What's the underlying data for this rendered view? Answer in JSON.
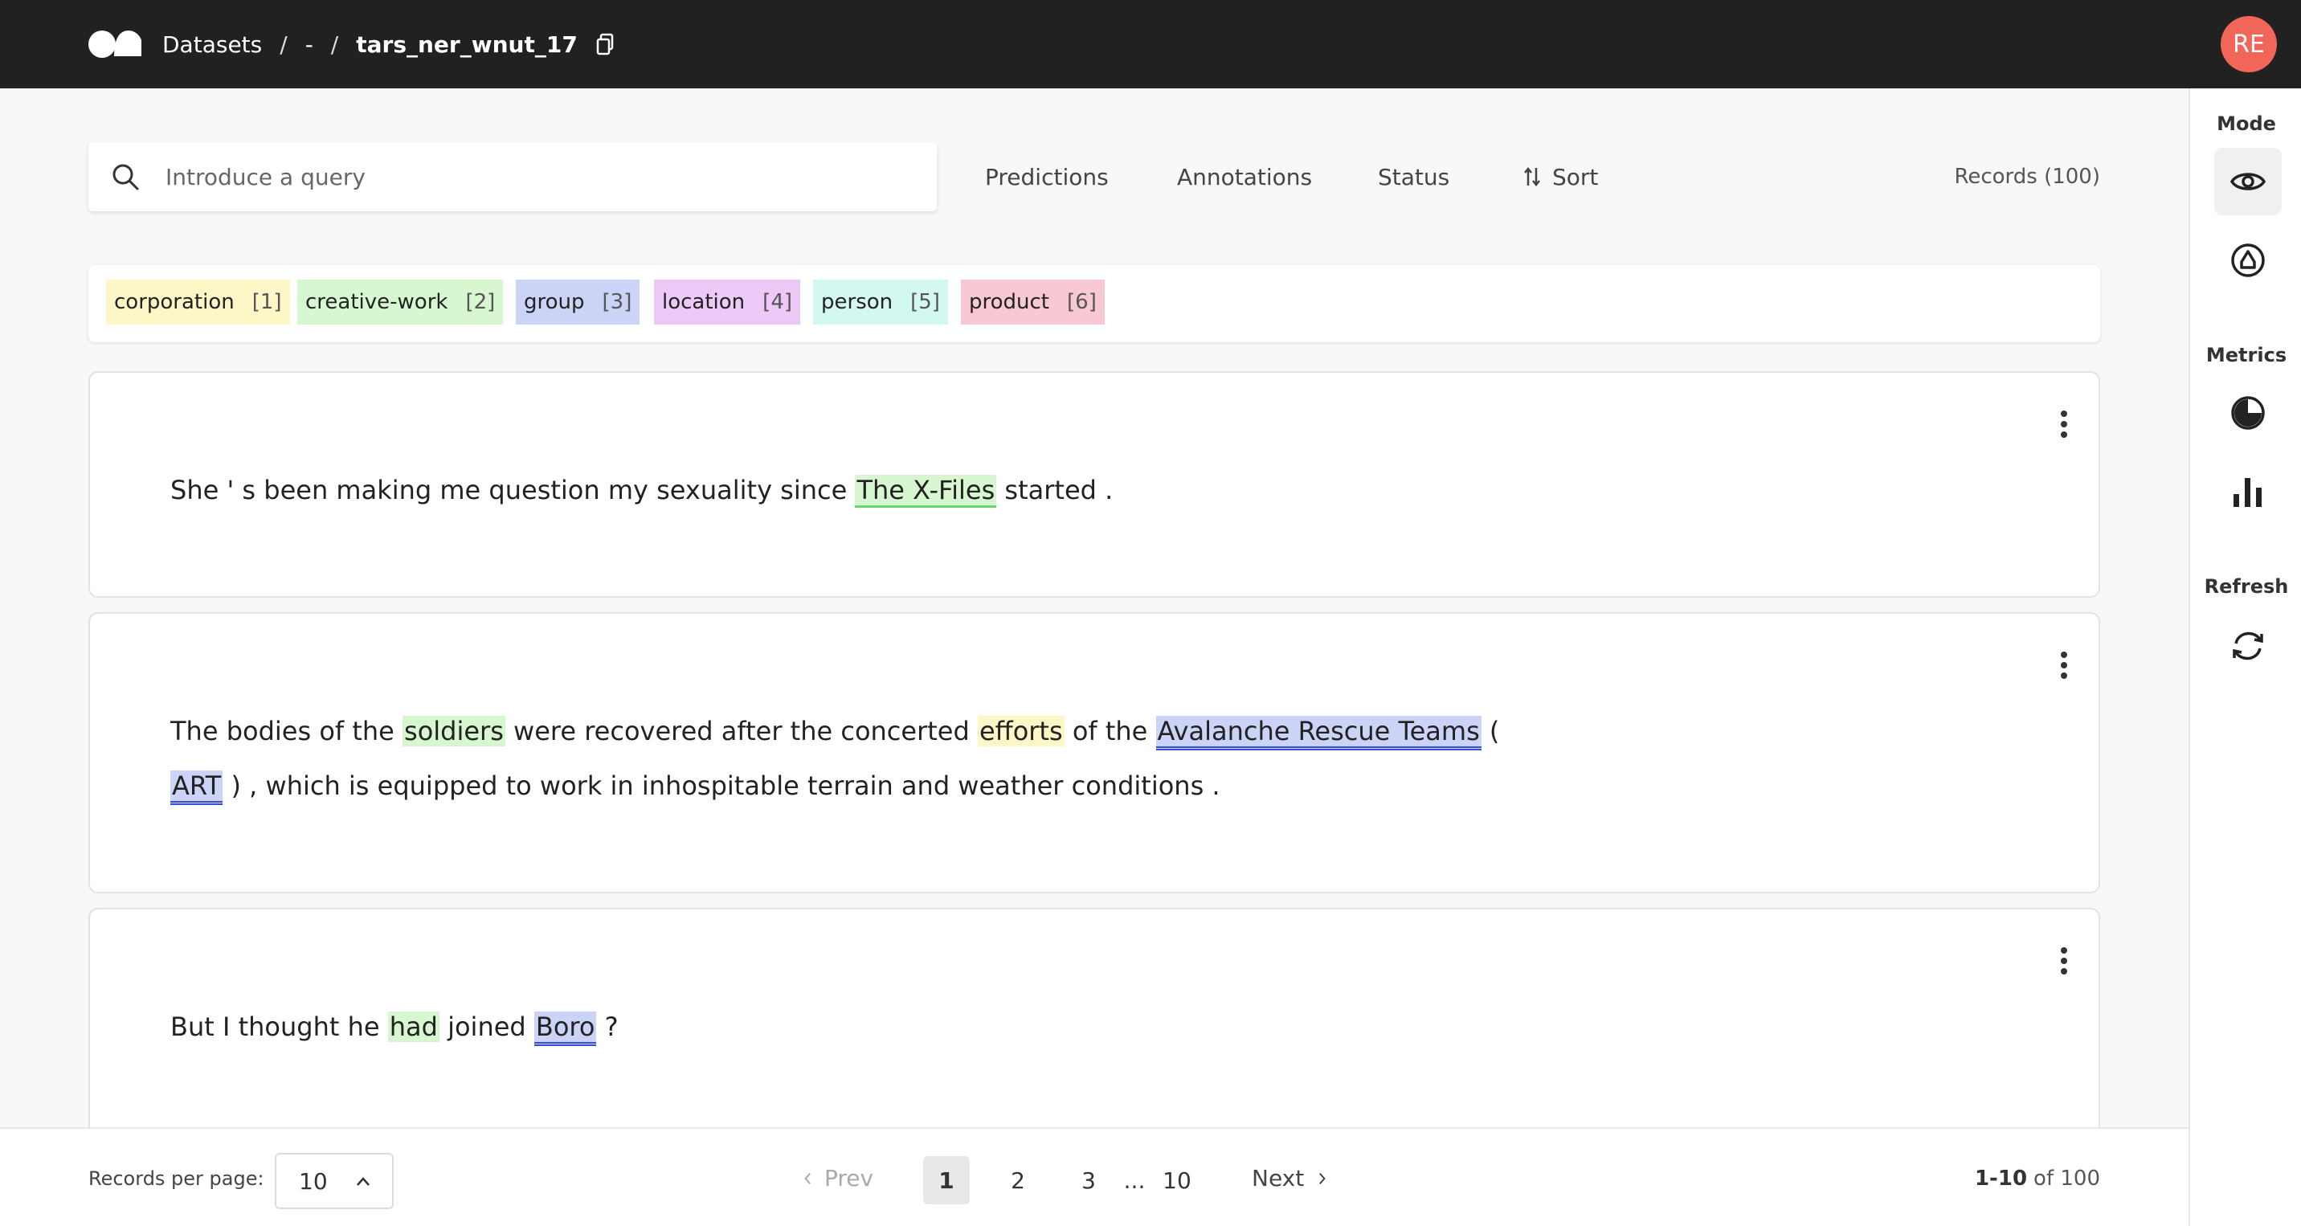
{
  "header": {
    "breadcrumb": [
      "Datasets",
      "-",
      "tars_ner_wnut_17"
    ],
    "separator": "/",
    "user_initials": "RE"
  },
  "search": {
    "placeholder": "Introduce a query"
  },
  "filters": [
    "Predictions",
    "Annotations",
    "Status",
    "Sort"
  ],
  "records_count": "Records (100)",
  "labels": [
    {
      "name": "corporation",
      "shortcut": "[1]",
      "color": "#fdf7c8"
    },
    {
      "name": "creative-work",
      "shortcut": "[2]",
      "color": "#d6f7d0"
    },
    {
      "name": "group",
      "shortcut": "[3]",
      "color": "#cbd4f6"
    },
    {
      "name": "location",
      "shortcut": "[4]",
      "color": "#ecc9f7"
    },
    {
      "name": "person",
      "shortcut": "[5]",
      "color": "#d3f8f0"
    },
    {
      "name": "product",
      "shortcut": "[6]",
      "color": "#f8c9d2"
    }
  ],
  "records": [
    {
      "line1": {
        "t1": "She ' s been making me question my sexuality since ",
        "e1": "The X-Files",
        "t2": " started ."
      }
    },
    {
      "line1": {
        "t1": "The bodies of the ",
        "e1": "soldiers",
        "t2": " were recovered after the concerted ",
        "e2": "efforts",
        "t3": " of the ",
        "e3": "Avalanche Rescue Teams",
        "t4": " ("
      },
      "line2": {
        "e1": "ART",
        "t1": " ) , which is equipped to work in inhospitable terrain and weather conditions ."
      }
    },
    {
      "line1": {
        "t1": "But I thought he ",
        "e1": "had",
        "t2": " joined ",
        "e2": "Boro",
        "t3": " ?"
      }
    }
  ],
  "sidebar": {
    "mode_label": "Mode",
    "metrics_label": "Metrics",
    "refresh_label": "Refresh",
    "icons": [
      "eye-icon",
      "annotate-icon",
      "progress-icon",
      "bar-chart-icon",
      "refresh-icon"
    ]
  },
  "footer": {
    "per_page_label": "Records per page:",
    "per_page_value": "10",
    "prev": "Prev",
    "next": "Next",
    "pages": [
      "1",
      "2",
      "3",
      "...",
      "10"
    ],
    "current_page": "1",
    "range_bold": "1-10",
    "range_rest": "of 100"
  }
}
